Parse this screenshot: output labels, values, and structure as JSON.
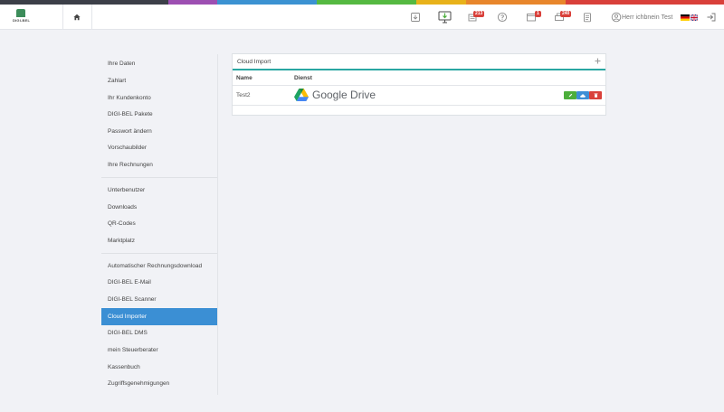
{
  "colors": {
    "strip": [
      "#3c3f48",
      "#9d4fb2",
      "#3b92d2",
      "#55b941",
      "#e8b21a",
      "#e8862c",
      "#d9403a"
    ],
    "accent": "#3b8fd4",
    "panel_underline": "#2aa7a2",
    "badge": "#d9403a",
    "edit": "#4cae3b",
    "cloud": "#3d8fd6",
    "delete": "#d9403a"
  },
  "header": {
    "logo_text": "DIGI-BEL",
    "home_icon": "home-icon",
    "icons": [
      "import-icon",
      "monitor-download-icon",
      "documents-icon",
      "help-icon",
      "inbox-icon",
      "print-icon",
      "clipboard-icon"
    ],
    "badges": {
      "documents": "213",
      "inbox": "1",
      "print": "240"
    },
    "user_name": "Herr ichbnein Test"
  },
  "sidebar": {
    "items": [
      {
        "label": "Ihre Daten"
      },
      {
        "label": "Zahlart"
      },
      {
        "label": "Ihr Kundenkonto"
      },
      {
        "label": "DIGI-BEL Pakete"
      },
      {
        "label": "Passwort ändern"
      },
      {
        "label": "Vorschaubilder"
      },
      {
        "label": "Ihre Rechnungen"
      },
      {
        "label": "Unterbenutzer"
      },
      {
        "label": "Downloads"
      },
      {
        "label": "QR-Codes"
      },
      {
        "label": "Marktplatz"
      },
      {
        "label": "Automatischer Rechnungsdownload"
      },
      {
        "label": "DIGI-BEL E-Mail"
      },
      {
        "label": "DIGI-BEL Scanner"
      },
      {
        "label": "Cloud Importer"
      },
      {
        "label": "DIGI-BEL DMS"
      },
      {
        "label": "mein Steuerberater"
      },
      {
        "label": "Kassenbuch"
      },
      {
        "label": "Zugriffsgenehmigungen"
      }
    ],
    "active": "Cloud Importer"
  },
  "panel": {
    "title": "Cloud Import",
    "add_icon": "plus-icon",
    "columns": [
      "Name",
      "Dienst"
    ],
    "rows": [
      {
        "name": "Test2",
        "service": "Google Drive"
      }
    ]
  }
}
